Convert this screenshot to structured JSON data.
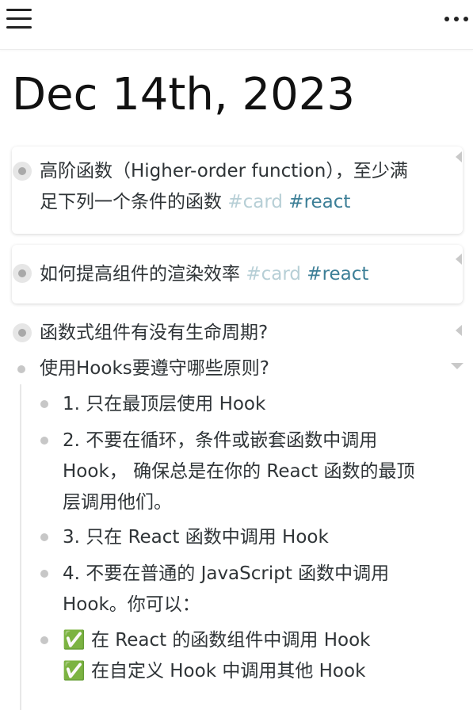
{
  "header": {
    "menu_icon": "hamburger-menu-icon",
    "more_icon": "more-dots-icon"
  },
  "page": {
    "title": "Dec 14th, 2023"
  },
  "blocks": [
    {
      "line1": "高阶函数（Higher-order function），至少满",
      "line2": "足下列一个条件的函数",
      "tags": [
        "#card",
        "#react"
      ]
    },
    {
      "line1": "如何提高组件的渲染效率",
      "tags": [
        "#card",
        "#react"
      ]
    },
    {
      "line1": "函数式组件有没有生命周期?"
    },
    {
      "line1": "使用Hooks要遵守哪些原则?",
      "children": [
        {
          "lines": [
            "1. 只在最顶层使用 Hook"
          ]
        },
        {
          "lines": [
            "2. 不要在循环，条件或嵌套函数中调用",
            "Hook， 确保总是在你的 React 函数的最顶",
            "层调用他们。"
          ]
        },
        {
          "lines": [
            "3. 只在 React 函数中调用 Hook"
          ]
        },
        {
          "lines": [
            "4. 不要在普通的 JavaScript 函数中调用",
            "Hook。你可以："
          ]
        },
        {
          "lines": [
            "✅ 在 React 的函数组件中调用 Hook",
            "✅ 在自定义 Hook 中调用其他 Hook"
          ]
        }
      ]
    }
  ],
  "colors": {
    "tag_card": "#b7cfd6",
    "tag_react": "#3d7f97",
    "text": "#2f3437"
  }
}
